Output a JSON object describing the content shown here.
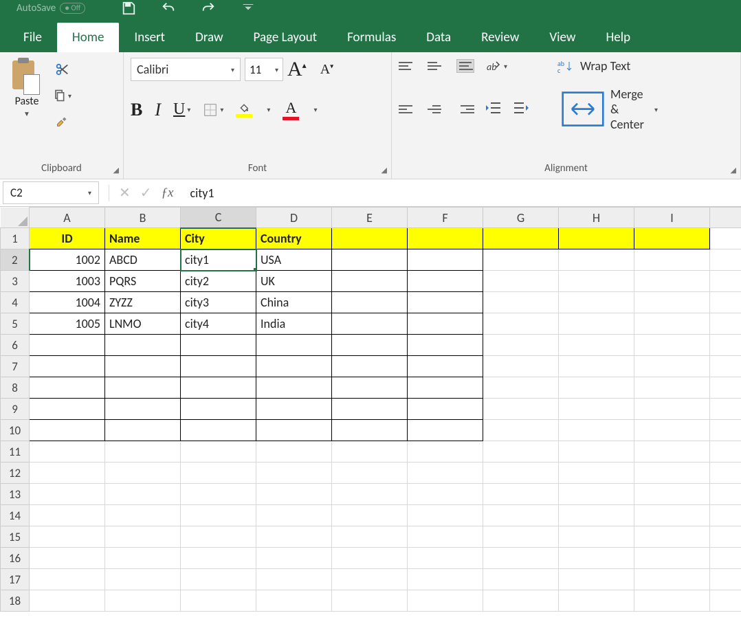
{
  "titlebar": {
    "autosave_label": "AutoSave",
    "autosave_state": "Off"
  },
  "tabs": {
    "file": "File",
    "home": "Home",
    "insert": "Insert",
    "draw": "Draw",
    "page_layout": "Page Layout",
    "formulas": "Formulas",
    "data": "Data",
    "review": "Review",
    "view": "View",
    "help": "Help"
  },
  "ribbon": {
    "clipboard": {
      "paste": "Paste",
      "group": "Clipboard"
    },
    "font": {
      "name": "Calibri",
      "size": "11",
      "group": "Font"
    },
    "alignment": {
      "wrap": "Wrap Text",
      "merge": "Merge & Center",
      "group": "Alignment"
    }
  },
  "namebox": "C2",
  "formula": "city1",
  "columns": [
    "A",
    "B",
    "C",
    "D",
    "E",
    "F",
    "G",
    "H",
    "I"
  ],
  "rows": [
    "1",
    "2",
    "3",
    "4",
    "5",
    "6",
    "7",
    "8",
    "9",
    "10",
    "11",
    "12",
    "13",
    "14",
    "15",
    "16",
    "17",
    "18"
  ],
  "selected": {
    "col": "C",
    "row": "2"
  },
  "data": {
    "headers": {
      "A": "ID",
      "B": "Name",
      "C": "City",
      "D": "Country"
    },
    "rows": [
      {
        "A": "1002",
        "B": "ABCD",
        "C": "city1",
        "D": "USA"
      },
      {
        "A": "1003",
        "B": "PQRS",
        "C": "city2",
        "D": "UK"
      },
      {
        "A": "1004",
        "B": "ZYZZ",
        "C": "city3",
        "D": "China"
      },
      {
        "A": "1005",
        "B": "LNMO",
        "C": "city4",
        "D": "India"
      }
    ]
  }
}
